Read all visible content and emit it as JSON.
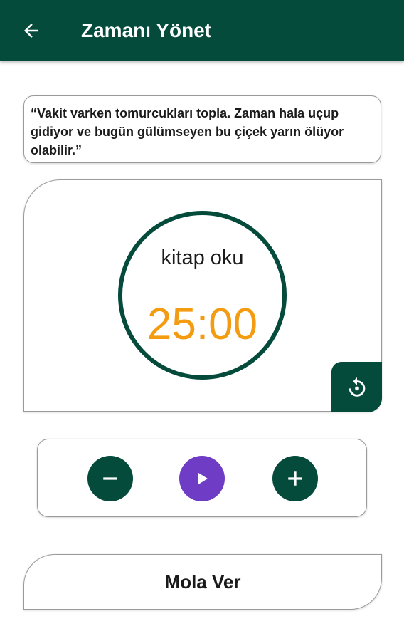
{
  "app_bar": {
    "title": "Zamanı Yönet",
    "back_icon": "arrow-back-icon",
    "background_color": "#044b3c"
  },
  "quote": {
    "text": "“Vakit varken tomurcukları topla. Zaman hala uçup gidiyor ve bugün gülümseyen bu çiçek yarın ölüyor olabilir.”"
  },
  "timer": {
    "task_name": "kitap oku",
    "time_remaining": "25:00",
    "time_color": "#f39c12",
    "ring_color": "#044b3c",
    "reset_icon": "restart-icon"
  },
  "controls": {
    "decrease_icon": "minus-icon",
    "play_icon": "play-icon",
    "increase_icon": "plus-icon",
    "play_color": "#6f3cc6"
  },
  "break_button": {
    "label": "Mola Ver"
  }
}
